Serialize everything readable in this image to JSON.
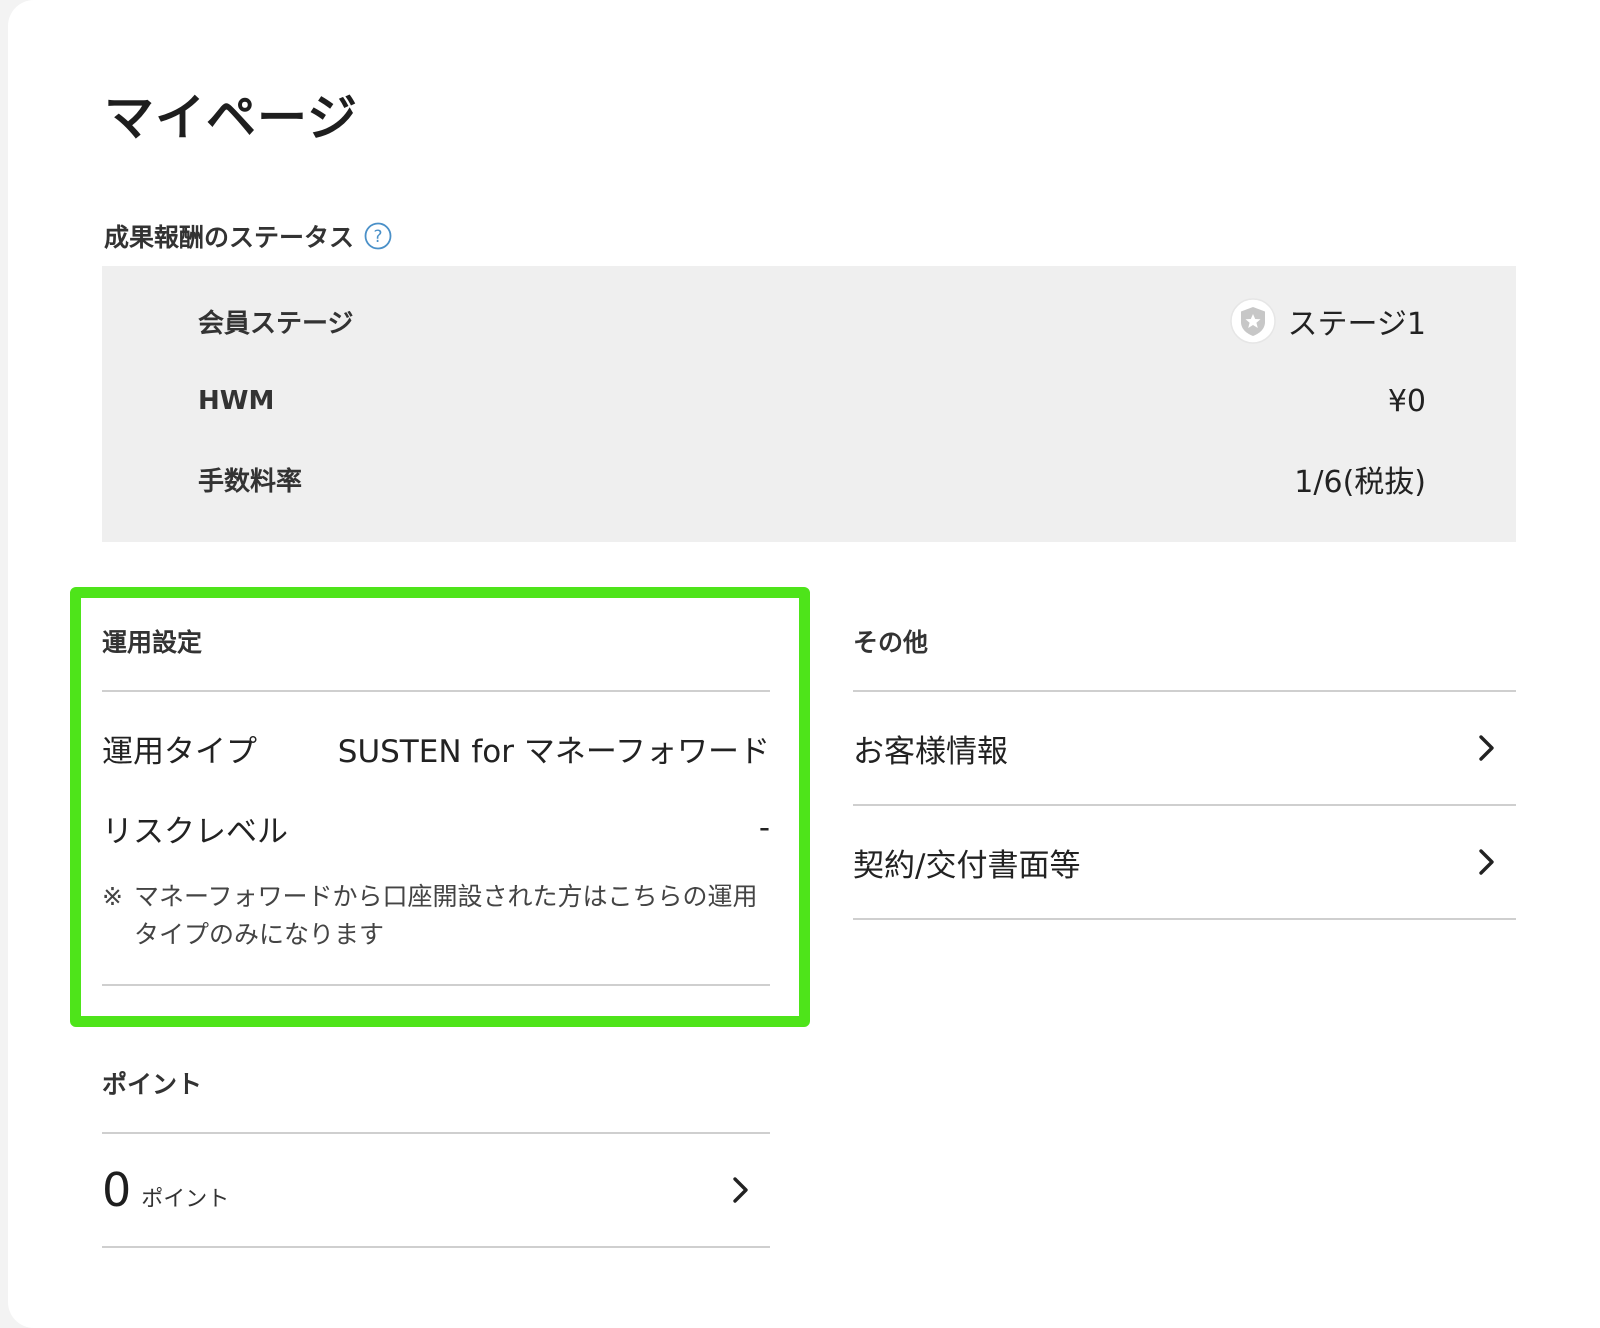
{
  "page": {
    "title": "マイページ"
  },
  "reward_status": {
    "heading": "成果報酬のステータス",
    "help_icon": "question-circle-icon",
    "rows": [
      {
        "label": "会員ステージ",
        "value": "ステージ1",
        "icon": "shield-star-icon"
      },
      {
        "label": "HWM",
        "value": "¥0"
      },
      {
        "label": "手数料率",
        "value": "1/6(税抜)"
      }
    ]
  },
  "operation_settings": {
    "heading": "運用設定",
    "rows": [
      {
        "label": "運用タイプ",
        "value": "SUSTEN for マネーフォワード"
      },
      {
        "label": "リスクレベル",
        "value": "-"
      }
    ],
    "note_mark": "※",
    "note": "マネーフォワードから口座開設された方はこちらの運用タイプのみになります"
  },
  "other": {
    "heading": "その他",
    "links": [
      {
        "label": "お客様情報"
      },
      {
        "label": "契約/交付書面等"
      }
    ]
  },
  "points": {
    "heading": "ポイント",
    "value": "0",
    "unit": "ポイント"
  },
  "colors": {
    "highlight": "#4ee41a",
    "status_bg": "#efefef",
    "help_icon": "#4a90c8",
    "divider": "#cfcfcf"
  }
}
